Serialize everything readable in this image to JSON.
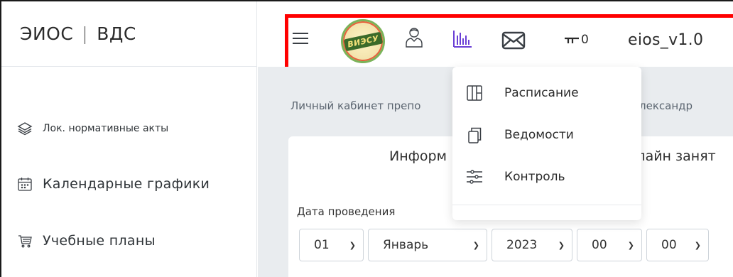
{
  "sidebar": {
    "brand_left": "ЭИОС",
    "brand_sep": "|",
    "brand_right": "ВДС",
    "items": [
      {
        "label": "Лок. нормативные акты",
        "icon": "layers-icon"
      },
      {
        "label": "Календарные графики",
        "icon": "calendar-icon"
      },
      {
        "label": "Учебные планы",
        "icon": "cart-icon"
      }
    ]
  },
  "header": {
    "logo_text": "ВИЭСУ",
    "icons": [
      "menu-icon",
      "user-icon",
      "chart-icon",
      "mail-icon",
      "key-icon"
    ],
    "key_count": "0",
    "version": "eios_v1.0",
    "highlight_color": "#ff0000"
  },
  "main": {
    "breadcrumb_left": "Личный кабинет препо",
    "breadcrumb_right": "на Александр",
    "card_title_left": "Информ",
    "card_title_right": "нлайн занят",
    "date_label": "Дата проведения",
    "selects": {
      "day": "01",
      "month": "Январь",
      "year": "2023",
      "hour": "00",
      "minute": "00"
    }
  },
  "dropdown": {
    "items": [
      {
        "label": "Расписание",
        "icon": "columns-icon"
      },
      {
        "label": "Ведомости",
        "icon": "copy-icon"
      },
      {
        "label": "Контроль",
        "icon": "sliders-icon"
      }
    ]
  }
}
